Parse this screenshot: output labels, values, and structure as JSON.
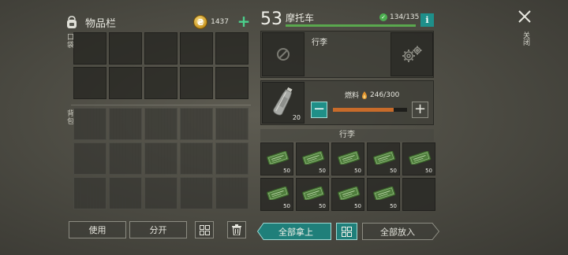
{
  "inventory": {
    "title": "物品栏",
    "coins": "1437",
    "pocket_label": "口袋",
    "backpack_label": "背包",
    "use_label": "使用",
    "split_label": "分开"
  },
  "vehicle": {
    "level": "53",
    "name": "摩托车",
    "durability": "134/135",
    "durability_fraction": 0.993,
    "info_label": "i",
    "trunk_label": "行李",
    "fuel_label": "燃料",
    "fuel_value": "246/300",
    "fuel_fraction": 0.82,
    "fuel_item_qty": "20",
    "cargo_header": "行李",
    "cargo": [
      {
        "item": "coupon",
        "qty": "50"
      },
      {
        "item": "coupon",
        "qty": "50"
      },
      {
        "item": "coupon",
        "qty": "50"
      },
      {
        "item": "coupon",
        "qty": "50"
      },
      {
        "item": "coupon",
        "qty": "50"
      },
      {
        "item": "coupon",
        "qty": "50"
      },
      {
        "item": "coupon",
        "qty": "50"
      },
      {
        "item": "coupon",
        "qty": "50"
      },
      {
        "item": "coupon",
        "qty": "50"
      },
      {
        "item": "empty",
        "qty": ""
      }
    ],
    "take_all_label": "全部拿上",
    "put_all_label": "全部放入"
  },
  "close_label": "关闭",
  "colors": {
    "accent_teal": "#1e8f8a",
    "durability_green": "#5aa84e",
    "fuel_orange": "#c86b2a",
    "coin_gold": "#c99520"
  },
  "icons": {
    "backpack": "backpack-icon",
    "coin": "coin-icon",
    "add": "plus-icon",
    "no_entry": "no-entry-icon",
    "gears": "gears-icon",
    "fuel_bottle": "fuel-bottle-icon",
    "flame": "flame-icon",
    "grid": "grid-icon",
    "trash": "trash-icon",
    "close": "close-icon"
  }
}
